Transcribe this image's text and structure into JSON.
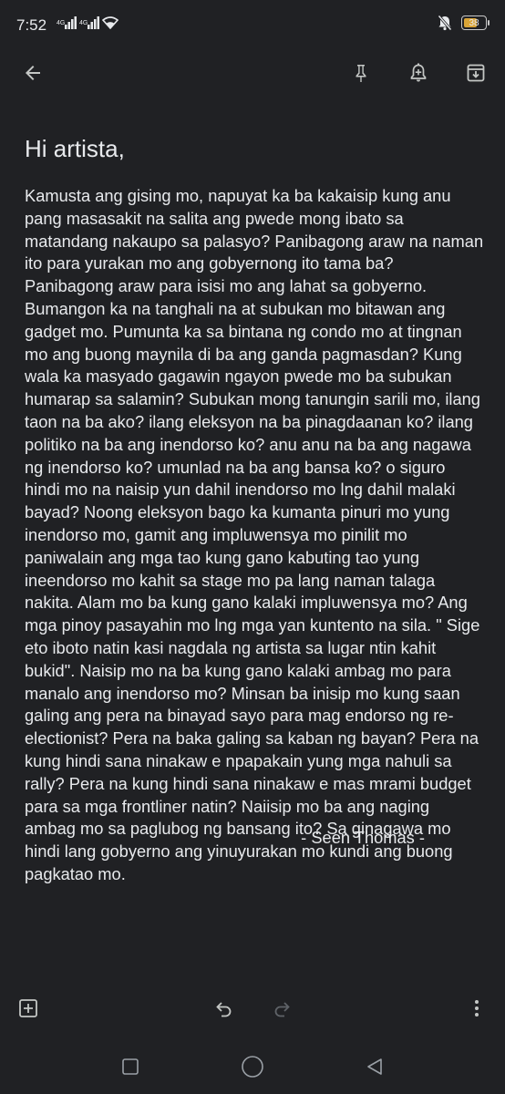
{
  "status_bar": {
    "time": "7:52",
    "battery_level": "38"
  },
  "note": {
    "title": "Hi artista,",
    "body": "Kamusta ang gising mo, napuyat ka ba kakaisip kung anu pang masasakit na salita ang pwede mong ibato sa matandang nakaupo sa palasyo? Panibagong araw na naman ito para yurakan mo ang gobyernong ito tama ba? Panibagong araw para isisi mo ang lahat sa gobyerno. Bumangon ka na tanghali na at subukan mo bitawan ang gadget mo. Pumunta ka sa bintana ng condo mo at tingnan mo ang buong maynila di ba ang ganda pagmasdan? Kung wala ka masyado gagawin ngayon pwede mo ba subukan humarap sa salamin? Subukan mong tanungin sarili mo, ilang taon na ba ako? ilang eleksyon na ba pinagdaanan ko? ilang politiko na ba ang inendorso ko? anu  anu na ba ang nagawa ng inendorso ko? umunlad na ba ang bansa ko? o siguro hindi mo na naisip yun dahil inendorso mo lng dahil malaki bayad? Noong eleksyon bago ka kumanta pinuri mo yung inendorso mo, gamit ang impluwensya mo pinilit mo paniwalain ang mga tao kung gano kabuting tao yung ineendorso mo kahit sa stage mo pa lang naman talaga nakita. Alam mo ba kung gano kalaki impluwensya mo? Ang mga pinoy pasayahin mo lng mga yan kuntento na sila. \" Sige eto iboto natin kasi nagdala ng artista sa lugar ntin kahit bukid\". Naisip mo na ba kung gano kalaki ambag mo para manalo ang inendorso mo? Minsan ba inisip mo kung saan galing ang pera na binayad sayo para mag endorso ng re-electionist? Pera na baka galing sa kaban ng bayan? Pera na kung hindi sana ninakaw e npapakain yung mga nahuli sa rally? Pera na kung hindi sana ninakaw e mas mrami budget para sa mga frontliner natin? Naiisip mo ba ang naging ambag mo sa paglubog ng bansang ito? Sa ginagawa mo hindi lang gobyerno ang yinuyurakan mo kundi ang buong pagkatao mo.",
    "signature": "- Seen Thomas -"
  },
  "icons": {
    "back": "arrow-back-icon",
    "pin": "pin-icon",
    "reminder": "add-alert-icon",
    "archive": "archive-icon",
    "add": "add-box-icon",
    "undo": "undo-icon",
    "redo": "redo-icon",
    "more": "more-vert-icon",
    "nav_recents": "square-icon",
    "nav_home": "circle-icon",
    "nav_back": "triangle-back-icon"
  },
  "colors": {
    "background": "#202124",
    "text": "#e8eaed",
    "battery": "#d9a437"
  }
}
